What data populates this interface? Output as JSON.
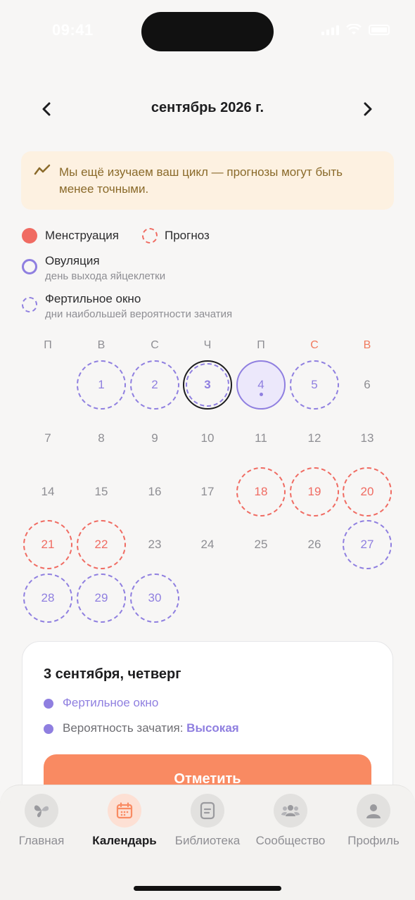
{
  "status": {
    "time": "09:41"
  },
  "header": {
    "month": "сентябрь 2026 г."
  },
  "notice": {
    "text": "Мы ещё изучаем ваш цикл — прогнозы могут быть менее точными."
  },
  "legend": {
    "menstruation": "Менструация",
    "forecast": "Прогноз",
    "ovulation": "Овуляция",
    "ovulation_sub": "день выхода яйцеклетки",
    "fertile": "Фертильное окно",
    "fertile_sub": "дни наибольшей вероятности зачатия"
  },
  "colors": {
    "menstruation": "#f06b62",
    "fertile": "#8f7fe0",
    "accent": "#f98a62"
  },
  "calendar": {
    "weekdays": [
      "П",
      "В",
      "С",
      "Ч",
      "П",
      "С",
      "В"
    ],
    "days": [
      {
        "n": "1",
        "state": "fertile"
      },
      {
        "n": "2",
        "state": "fertile"
      },
      {
        "n": "3",
        "state": "selected"
      },
      {
        "n": "4",
        "state": "ovulation"
      },
      {
        "n": "5",
        "state": "fertile"
      },
      {
        "n": "6",
        "state": "normal"
      },
      {
        "n": "7",
        "state": "normal"
      },
      {
        "n": "8",
        "state": "normal"
      },
      {
        "n": "9",
        "state": "normal"
      },
      {
        "n": "10",
        "state": "normal"
      },
      {
        "n": "11",
        "state": "normal"
      },
      {
        "n": "12",
        "state": "normal"
      },
      {
        "n": "13",
        "state": "normal"
      },
      {
        "n": "14",
        "state": "normal"
      },
      {
        "n": "15",
        "state": "normal"
      },
      {
        "n": "16",
        "state": "normal"
      },
      {
        "n": "17",
        "state": "normal"
      },
      {
        "n": "18",
        "state": "forecast"
      },
      {
        "n": "19",
        "state": "forecast"
      },
      {
        "n": "20",
        "state": "forecast"
      },
      {
        "n": "21",
        "state": "forecast"
      },
      {
        "n": "22",
        "state": "forecast"
      },
      {
        "n": "23",
        "state": "normal"
      },
      {
        "n": "24",
        "state": "normal"
      },
      {
        "n": "25",
        "state": "normal"
      },
      {
        "n": "26",
        "state": "normal"
      },
      {
        "n": "27",
        "state": "fertile"
      },
      {
        "n": "28",
        "state": "fertile"
      },
      {
        "n": "29",
        "state": "fertile"
      },
      {
        "n": "30",
        "state": "fertile"
      }
    ]
  },
  "detail": {
    "title": "3 сентября, четверг",
    "fertile_label": "Фертильное окно",
    "probability_label": "Вероятность зачатия:",
    "probability_value": "Высокая",
    "button": "Отметить"
  },
  "tabs": [
    {
      "label": "Главная",
      "icon": "butterfly-icon",
      "active": false
    },
    {
      "label": "Календарь",
      "icon": "calendar-icon",
      "active": true
    },
    {
      "label": "Библиотека",
      "icon": "library-icon",
      "active": false
    },
    {
      "label": "Сообщество",
      "icon": "community-icon",
      "active": false
    },
    {
      "label": "Профиль",
      "icon": "profile-icon",
      "active": false
    }
  ]
}
